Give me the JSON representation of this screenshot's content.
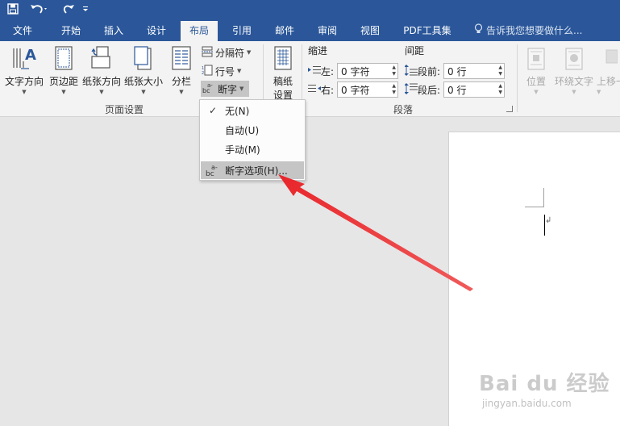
{
  "quick_access": {
    "icons": [
      "save-icon",
      "undo-icon",
      "redo-icon",
      "customize-icon"
    ]
  },
  "tabs": [
    {
      "label": "文件",
      "active": false
    },
    {
      "label": "开始",
      "active": false
    },
    {
      "label": "插入",
      "active": false
    },
    {
      "label": "设计",
      "active": false
    },
    {
      "label": "布局",
      "active": true
    },
    {
      "label": "引用",
      "active": false
    },
    {
      "label": "邮件",
      "active": false
    },
    {
      "label": "审阅",
      "active": false
    },
    {
      "label": "视图",
      "active": false
    },
    {
      "label": "PDF工具集",
      "active": false
    }
  ],
  "tell_me": {
    "placeholder": "告诉我您想要做什么..."
  },
  "page_setup": {
    "group_label": "页面设置",
    "text_direction": "文字方向",
    "margins": "页边距",
    "orientation": "纸张方向",
    "size": "纸张大小",
    "columns": "分栏",
    "breaks": "分隔符",
    "line_numbers": "行号",
    "hyphenation": "断字"
  },
  "draft": {
    "label_line1": "稿纸",
    "label_line2": "设置"
  },
  "paragraph": {
    "group_label": "段落",
    "indent_header": "缩进",
    "spacing_header": "间距",
    "indent_left_label": "左:",
    "indent_left_value": "0 字符",
    "indent_right_label": "右:",
    "indent_right_value": "0 字符",
    "spacing_before_label": "段前:",
    "spacing_before_value": "0 行",
    "spacing_after_label": "段后:",
    "spacing_after_value": "0 行"
  },
  "arrange": {
    "position": "位置",
    "wrap_text": "环绕文字",
    "bring_forward": "上移一"
  },
  "hyphenation_menu": {
    "items": [
      {
        "label": "无(N)",
        "checked": true,
        "highlighted": false
      },
      {
        "label": "自动(U)",
        "checked": false,
        "highlighted": false
      },
      {
        "label": "手动(M)",
        "checked": false,
        "highlighted": false
      },
      {
        "label": "断字选项(H)...",
        "checked": false,
        "highlighted": true
      }
    ]
  },
  "document": {
    "paragraph_mark": "↲"
  },
  "watermark": {
    "brand": "Bai du 经验",
    "url": "jingyan.baidu.com"
  },
  "colors": {
    "accent": "#2b579a",
    "annotation": "#f03a3a",
    "ribbon": "#f3f3f3",
    "canvas": "#e6e6e6"
  }
}
